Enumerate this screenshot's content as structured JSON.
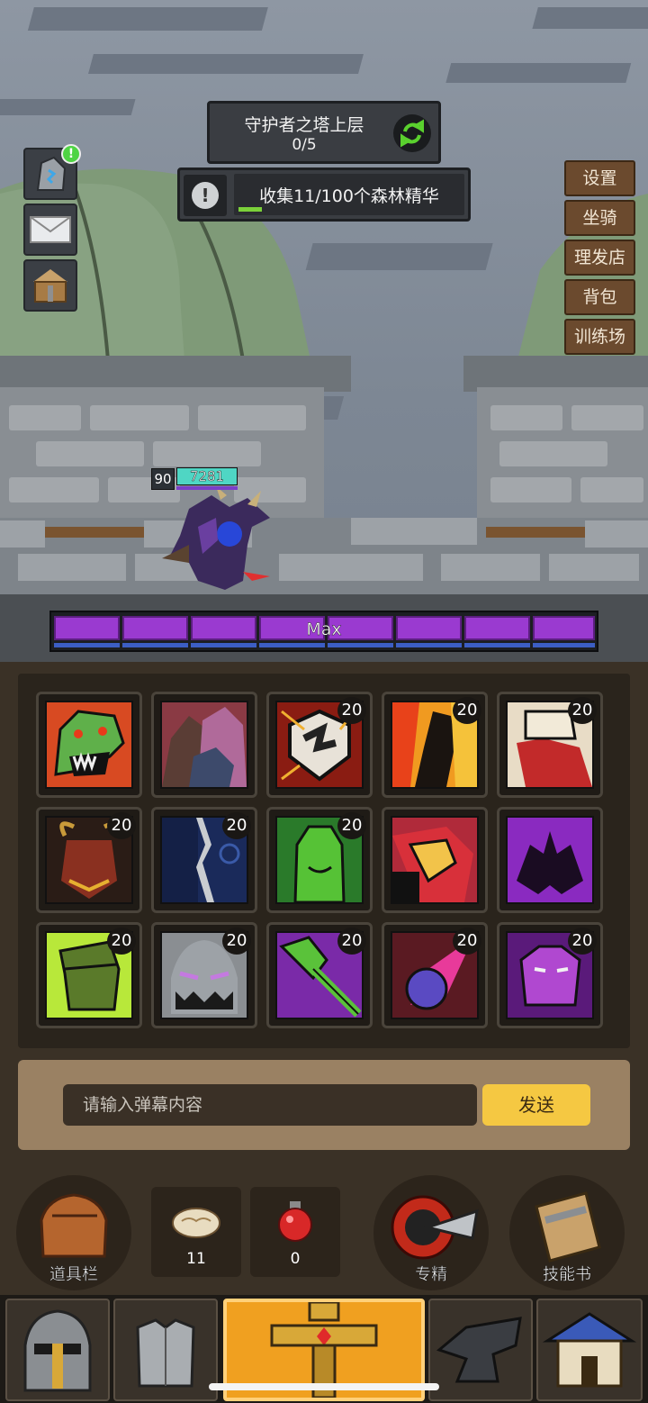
{
  "quest": {
    "tower_title": "守护者之塔上层",
    "tower_progress": "0/5",
    "collect_text": "收集11/100个森林精华",
    "alert_symbol": "!"
  },
  "left_icons": [
    {
      "name": "rune-stone-icon",
      "badge": "!"
    },
    {
      "name": "mail-icon"
    },
    {
      "name": "treasure-chest-icon"
    }
  ],
  "right_menu": [
    "设置",
    "坐骑",
    "理发店",
    "背包",
    "训练场"
  ],
  "hero": {
    "level": "90",
    "hp": "7281"
  },
  "max_bar": {
    "label": "Max"
  },
  "skills": [
    {
      "icon": "lizard-roar-skill-icon",
      "level": ""
    },
    {
      "icon": "hooded-figures-skill-icon",
      "level": ""
    },
    {
      "icon": "broken-shield-skill-icon",
      "level": "20"
    },
    {
      "icon": "flame-silhouette-skill-icon",
      "level": "20"
    },
    {
      "icon": "red-fist-skill-icon",
      "level": "20"
    },
    {
      "icon": "horned-demon-skill-icon",
      "level": "20"
    },
    {
      "icon": "cracked-wall-skill-icon",
      "level": "20"
    },
    {
      "icon": "green-fist-skill-icon",
      "level": "20"
    },
    {
      "icon": "red-armor-skill-icon",
      "level": "20"
    },
    {
      "icon": "purple-raven-skill-icon",
      "level": "20"
    },
    {
      "icon": "green-fist-block-skill-icon",
      "level": "20"
    },
    {
      "icon": "grey-monster-skill-icon",
      "level": "20"
    },
    {
      "icon": "green-mace-skill-icon",
      "level": "20"
    },
    {
      "icon": "pink-meteor-skill-icon",
      "level": "20"
    },
    {
      "icon": "purple-goblin-skill-icon",
      "level": "20"
    }
  ],
  "barrage": {
    "placeholder": "请输入弹幕内容",
    "send_label": "发送"
  },
  "actions": {
    "inventory_label": "道具栏",
    "bread_count": "11",
    "potion_count": "0",
    "specialize_label": "专精",
    "skillbook_label": "技能书"
  },
  "nav": [
    {
      "icon": "helmet-icon"
    },
    {
      "icon": "chest-armor-icon"
    },
    {
      "icon": "hilt-sword-icon"
    },
    {
      "icon": "anvil-icon"
    },
    {
      "icon": "shop-house-icon"
    }
  ],
  "colors": {
    "skill_level_bar": "#9a3ad0",
    "send_button": "#f5c842",
    "active_tab": "#f0a020"
  }
}
